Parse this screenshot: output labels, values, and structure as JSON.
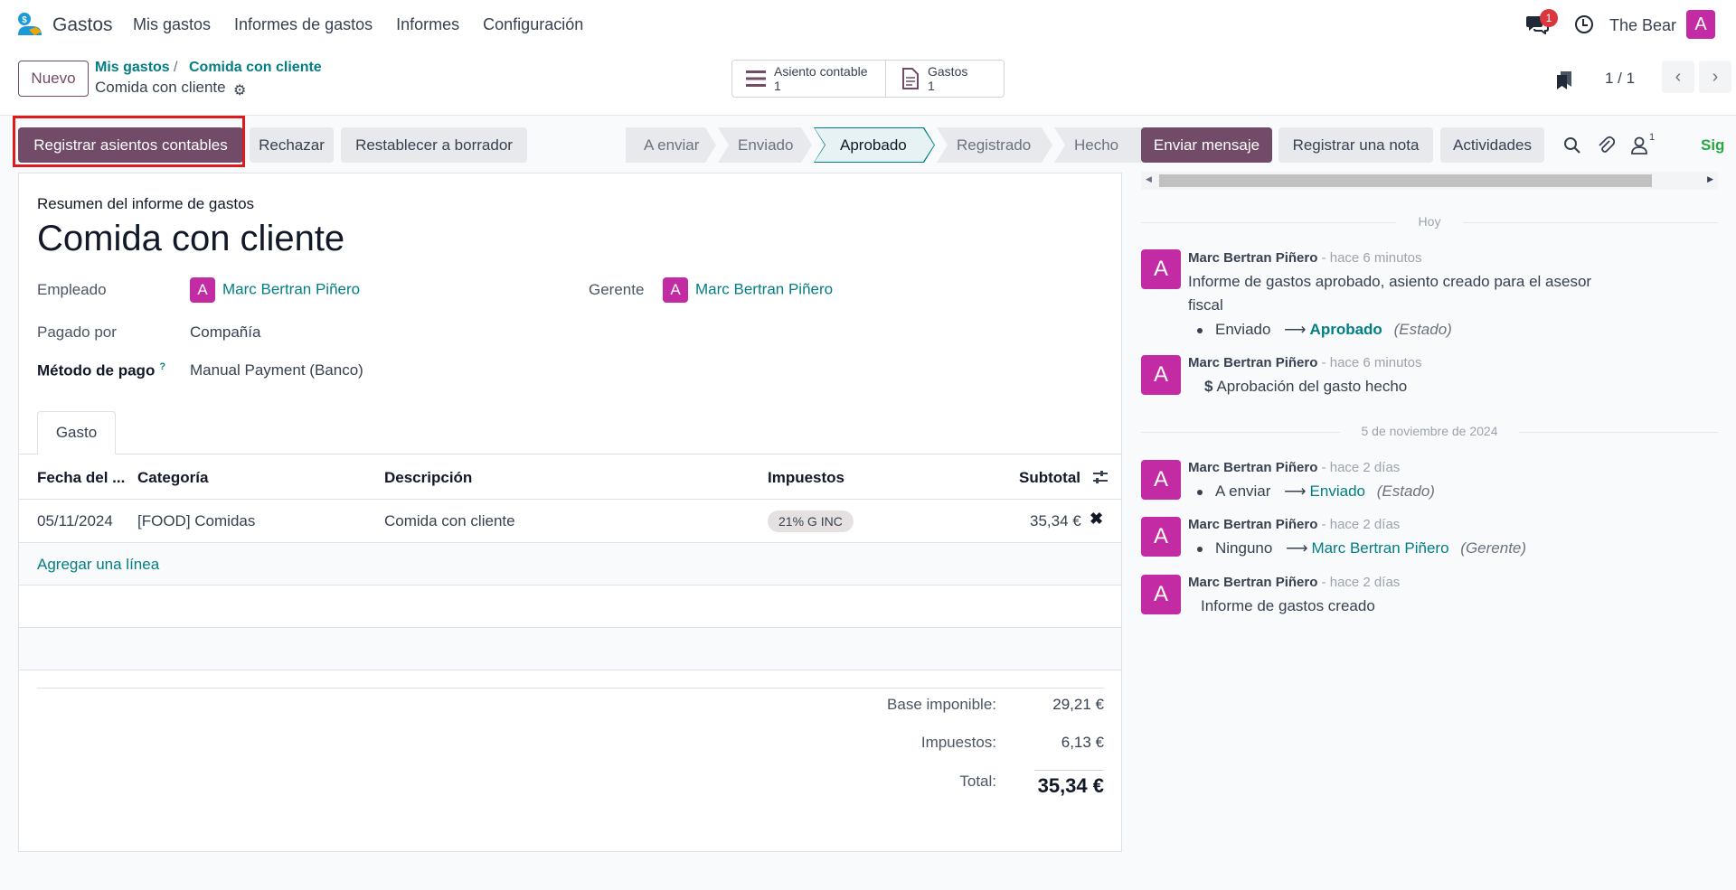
{
  "navbar": {
    "app_name": "Gastos",
    "menu": [
      "Mis gastos",
      "Informes de gastos",
      "Informes",
      "Configuración"
    ],
    "chat_badge": "1",
    "user_name": "The Bear",
    "avatar_letter": "A"
  },
  "control": {
    "new_label": "Nuevo",
    "breadcrumb": [
      "Mis gastos",
      "Comida con cliente"
    ],
    "current": "Comida con cliente",
    "smart_buttons": [
      {
        "label": "Asiento contable",
        "count": "1"
      },
      {
        "label": "Gastos",
        "count": "1"
      }
    ],
    "pager": "1 / 1"
  },
  "actions": {
    "post": "Registrar asientos contables",
    "refuse": "Rechazar",
    "reset": "Restablecer a borrador"
  },
  "status_steps": [
    "A enviar",
    "Enviado",
    "Aprobado",
    "Registrado",
    "Hecho"
  ],
  "active_step": "Aprobado",
  "sheet": {
    "subtitle": "Resumen del informe de gastos",
    "title": "Comida con cliente",
    "employee_label": "Empleado",
    "employee": "Marc Bertran Piñero",
    "manager_label": "Gerente",
    "manager": "Marc Bertran Piñero",
    "paid_by_label": "Pagado por",
    "paid_by": "Compañía",
    "payment_label": "Método de pago",
    "payment_help": "?",
    "payment": "Manual Payment (Banco)",
    "tab": "Gasto",
    "columns": [
      "Fecha del ...",
      "Categoría",
      "Descripción",
      "Impuestos",
      "Subtotal"
    ],
    "line": {
      "date": "05/11/2024",
      "category": "[FOOD] Comidas",
      "description": "Comida con cliente",
      "tax": "21% G INC",
      "subtotal": "35,34 €"
    },
    "add_line": "Agregar una línea",
    "totals": {
      "base_label": "Base imponible:",
      "base": "29,21 €",
      "tax_label": "Impuestos:",
      "tax": "6,13 €",
      "total_label": "Total:",
      "total": "35,34 €"
    }
  },
  "chatter": {
    "send_message": "Enviar mensaje",
    "log_note": "Registrar una nota",
    "activities": "Actividades",
    "followers_count": "1",
    "follow": "Sig",
    "date_today": "Hoy",
    "date_older": "5 de noviembre de 2024",
    "messages": [
      {
        "author": "Marc Bertran Piñero",
        "time": "- hace 6 minutos",
        "body": "Informe de gastos aprobado, asiento creado para el asesor fiscal",
        "from": "Enviado",
        "to": "Aprobado",
        "field": "(Estado)"
      },
      {
        "author": "Marc Bertran Piñero",
        "time": "- hace 6 minutos",
        "body": "Aprobación del gasto hecho"
      },
      {
        "author": "Marc Bertran Piñero",
        "time": "- hace 2 días",
        "from": "A enviar",
        "to": "Enviado",
        "field": "(Estado)"
      },
      {
        "author": "Marc Bertran Piñero",
        "time": "- hace 2 días",
        "from": "Ninguno",
        "to": "Marc Bertran Piñero",
        "field": "(Gerente)"
      },
      {
        "author": "Marc Bertran Piñero",
        "time": "- hace 2 días",
        "body": "Informe de gastos creado"
      }
    ]
  },
  "colors": {
    "primary": "#714b67",
    "link": "#017e84",
    "avatar": "#c32ba5",
    "highlight": "#e0191f"
  }
}
